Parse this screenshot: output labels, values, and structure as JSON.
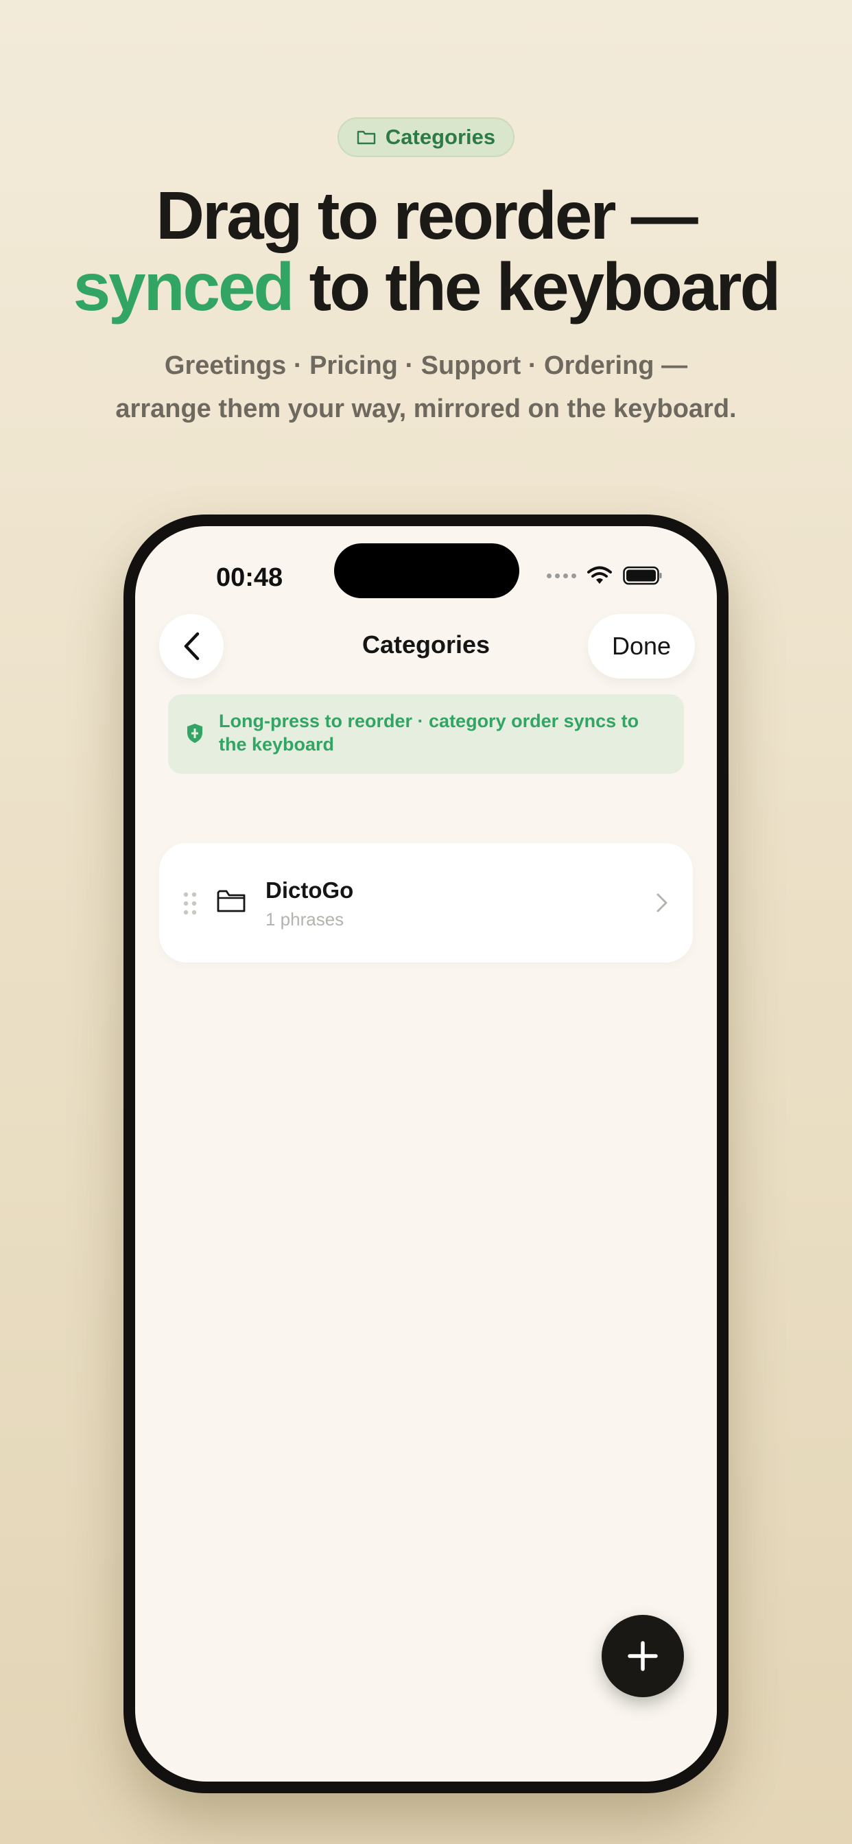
{
  "badge": {
    "label": "Categories",
    "icon": "folder-icon"
  },
  "headline": {
    "line1": "Drag to reorder —",
    "accent": "synced",
    "line2_rest": " to the keyboard"
  },
  "subhead": {
    "line1": "Greetings · Pricing · Support · Ordering —",
    "line2": "arrange them your way, mirrored on the keyboard."
  },
  "status_bar": {
    "time": "00:48"
  },
  "nav": {
    "title": "Categories",
    "done_label": "Done"
  },
  "info_banner": {
    "line1": "Long-press to reorder · category order syncs to",
    "line2": "the keyboard",
    "icon": "shield-icon"
  },
  "categories": [
    {
      "name": "DictoGo",
      "count": "1 phrases"
    }
  ],
  "colors": {
    "accent": "#32a463",
    "dark": "#1a1814",
    "banner_bg": "#e6eee0"
  }
}
